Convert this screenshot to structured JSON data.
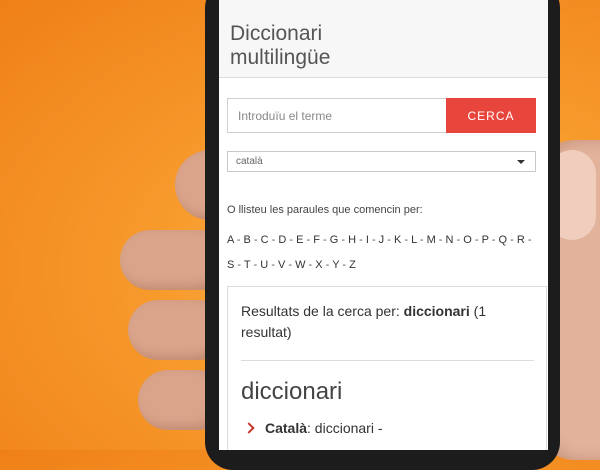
{
  "header": {
    "title": "Diccionari\nmultilingüe"
  },
  "search": {
    "placeholder": "Introduïu el terme",
    "button_label": "CERCA"
  },
  "language_select": {
    "value": "català"
  },
  "browse": {
    "label": "O llisteu les paraules que comencin per:",
    "letters": [
      "A",
      "B",
      "C",
      "D",
      "E",
      "F",
      "G",
      "H",
      "I",
      "J",
      "K",
      "L",
      "M",
      "N",
      "O",
      "P",
      "Q",
      "R",
      "S",
      "T",
      "U",
      "V",
      "W",
      "X",
      "Y",
      "Z"
    ]
  },
  "results": {
    "heading_prefix": "Resultats de la cerca per: ",
    "query": "diccionari",
    "count_text": " (1 resultat)",
    "word": "diccionari",
    "entries": [
      {
        "language": "Català",
        "text": ": diccionari -"
      }
    ]
  },
  "colors": {
    "accent": "#e8453c",
    "background": "#f79a2c"
  }
}
